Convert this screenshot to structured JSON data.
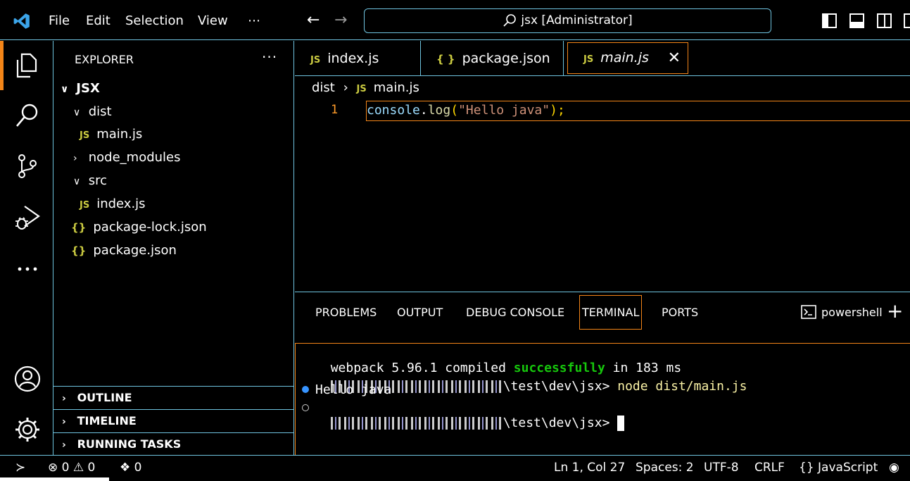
{
  "titlebar": {
    "menus": [
      "File",
      "Edit",
      "Selection",
      "View",
      "⋯"
    ],
    "search_text": "jsx [Administrator]"
  },
  "sidebar": {
    "title": "EXPLORER",
    "more": "···",
    "root": "JSX",
    "items": [
      {
        "label": "dist",
        "type": "folder",
        "expanded": true
      },
      {
        "label": "main.js",
        "type": "js"
      },
      {
        "label": "node_modules",
        "type": "folder",
        "expanded": false
      },
      {
        "label": "src",
        "type": "folder",
        "expanded": true
      },
      {
        "label": "index.js",
        "type": "js"
      },
      {
        "label": "package-lock.json",
        "type": "json"
      },
      {
        "label": "package.json",
        "type": "json"
      }
    ],
    "sections": [
      "OUTLINE",
      "TIMELINE",
      "RUNNING TASKS"
    ]
  },
  "editor": {
    "tabs": [
      {
        "label": "index.js",
        "badge": "JS"
      },
      {
        "label": "package.json",
        "badge": "{ }"
      },
      {
        "label": "main.js",
        "badge": "JS",
        "active": true
      }
    ],
    "breadcrumb": {
      "folder": "dist",
      "file": "main.js"
    },
    "lines": [
      {
        "num": "1",
        "obj": "console",
        "dot": ".",
        "fn": "log",
        "open": "(",
        "str": "\"Hello java\"",
        "close": ");"
      }
    ]
  },
  "panel": {
    "tabs": [
      "PROBLEMS",
      "OUTPUT",
      "DEBUG CONSOLE",
      "TERMINAL",
      "PORTS"
    ],
    "active_tab": "TERMINAL",
    "shell": "powershell",
    "terminal": {
      "l1_a": "webpack 5.96.1 compiled ",
      "l1_b": "successfully",
      "l1_c": " in 183 ms",
      "l2_path": "\\test\\dev\\jsx> ",
      "l2_cmd": "node dist/main.js",
      "l3": "Hello java",
      "l4_path": "\\test\\dev\\jsx> "
    }
  },
  "statusbar": {
    "errors": "0",
    "warnings": "0",
    "ports": "0",
    "position": "Ln 1, Col 27",
    "spaces": "Spaces: 2",
    "encoding": "UTF-8",
    "eol": "CRLF",
    "language": "JavaScript"
  },
  "colors": {
    "accent": "#f38518",
    "border": "#6fc3df",
    "badge": "#cbcb41"
  }
}
